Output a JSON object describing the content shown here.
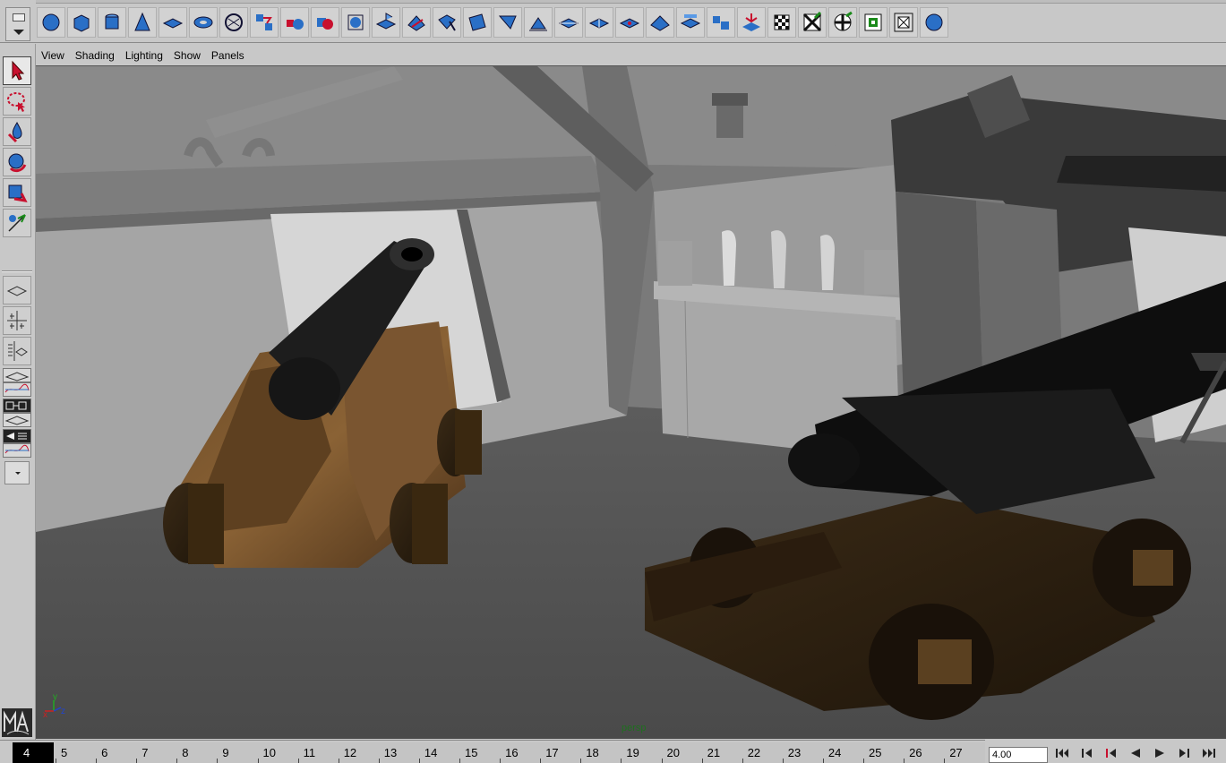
{
  "shelf": {
    "icons": [
      {
        "name": "poly-sphere-icon"
      },
      {
        "name": "poly-cube-icon"
      },
      {
        "name": "poly-cylinder-icon"
      },
      {
        "name": "poly-cone-icon"
      },
      {
        "name": "poly-plane-icon"
      },
      {
        "name": "poly-torus-icon"
      },
      {
        "name": "poly-pipe-icon"
      },
      {
        "name": "combine-icon"
      },
      {
        "name": "separate-icon"
      },
      {
        "name": "boolean-icon"
      },
      {
        "name": "smooth-icon"
      },
      {
        "name": "extrude-face-icon"
      },
      {
        "name": "split-polygon-icon"
      },
      {
        "name": "bevel-icon"
      },
      {
        "name": "append-polygon-icon"
      },
      {
        "name": "merge-icon"
      },
      {
        "name": "wedge-face-icon"
      },
      {
        "name": "poke-face-icon"
      },
      {
        "name": "cut-faces-icon"
      },
      {
        "name": "split-edge-icon"
      },
      {
        "name": "sculpt-icon"
      },
      {
        "name": "collapse-icon"
      },
      {
        "name": "duplicate-face-icon"
      },
      {
        "name": "extract-icon"
      },
      {
        "name": "project-uv-icon"
      },
      {
        "name": "uv-planar-icon"
      },
      {
        "name": "uv-cylindrical-icon"
      },
      {
        "name": "uv-spherical-icon"
      },
      {
        "name": "uv-auto-icon"
      },
      {
        "name": "uv-texture-editor-icon"
      }
    ]
  },
  "panel_menu": {
    "view": "View",
    "shading": "Shading",
    "lighting": "Lighting",
    "show": "Show",
    "panels": "Panels"
  },
  "viewport": {
    "camera": "persp",
    "axis_x": "x",
    "axis_y": "y",
    "axis_z": "z"
  },
  "toolbox": {
    "logo": "Maya",
    "tools": [
      "select-tool-icon",
      "lasso-tool-icon",
      "paint-select-tool-icon",
      "move-tool-icon",
      "rotate-tool-icon",
      "scale-tool-icon"
    ]
  },
  "timeslider": {
    "current_frame": "4",
    "ticks": [
      "5",
      "6",
      "7",
      "8",
      "9",
      "10",
      "11",
      "12",
      "13",
      "14",
      "15",
      "16",
      "17",
      "18",
      "19",
      "20",
      "21",
      "22",
      "23",
      "24",
      "25",
      "26",
      "27"
    ],
    "current_time_value": "4.00"
  },
  "colors": {
    "ui_bg": "#c8c8c8",
    "icon_blue": "#2a6fc6",
    "camera_label": "#1f6f1f"
  }
}
